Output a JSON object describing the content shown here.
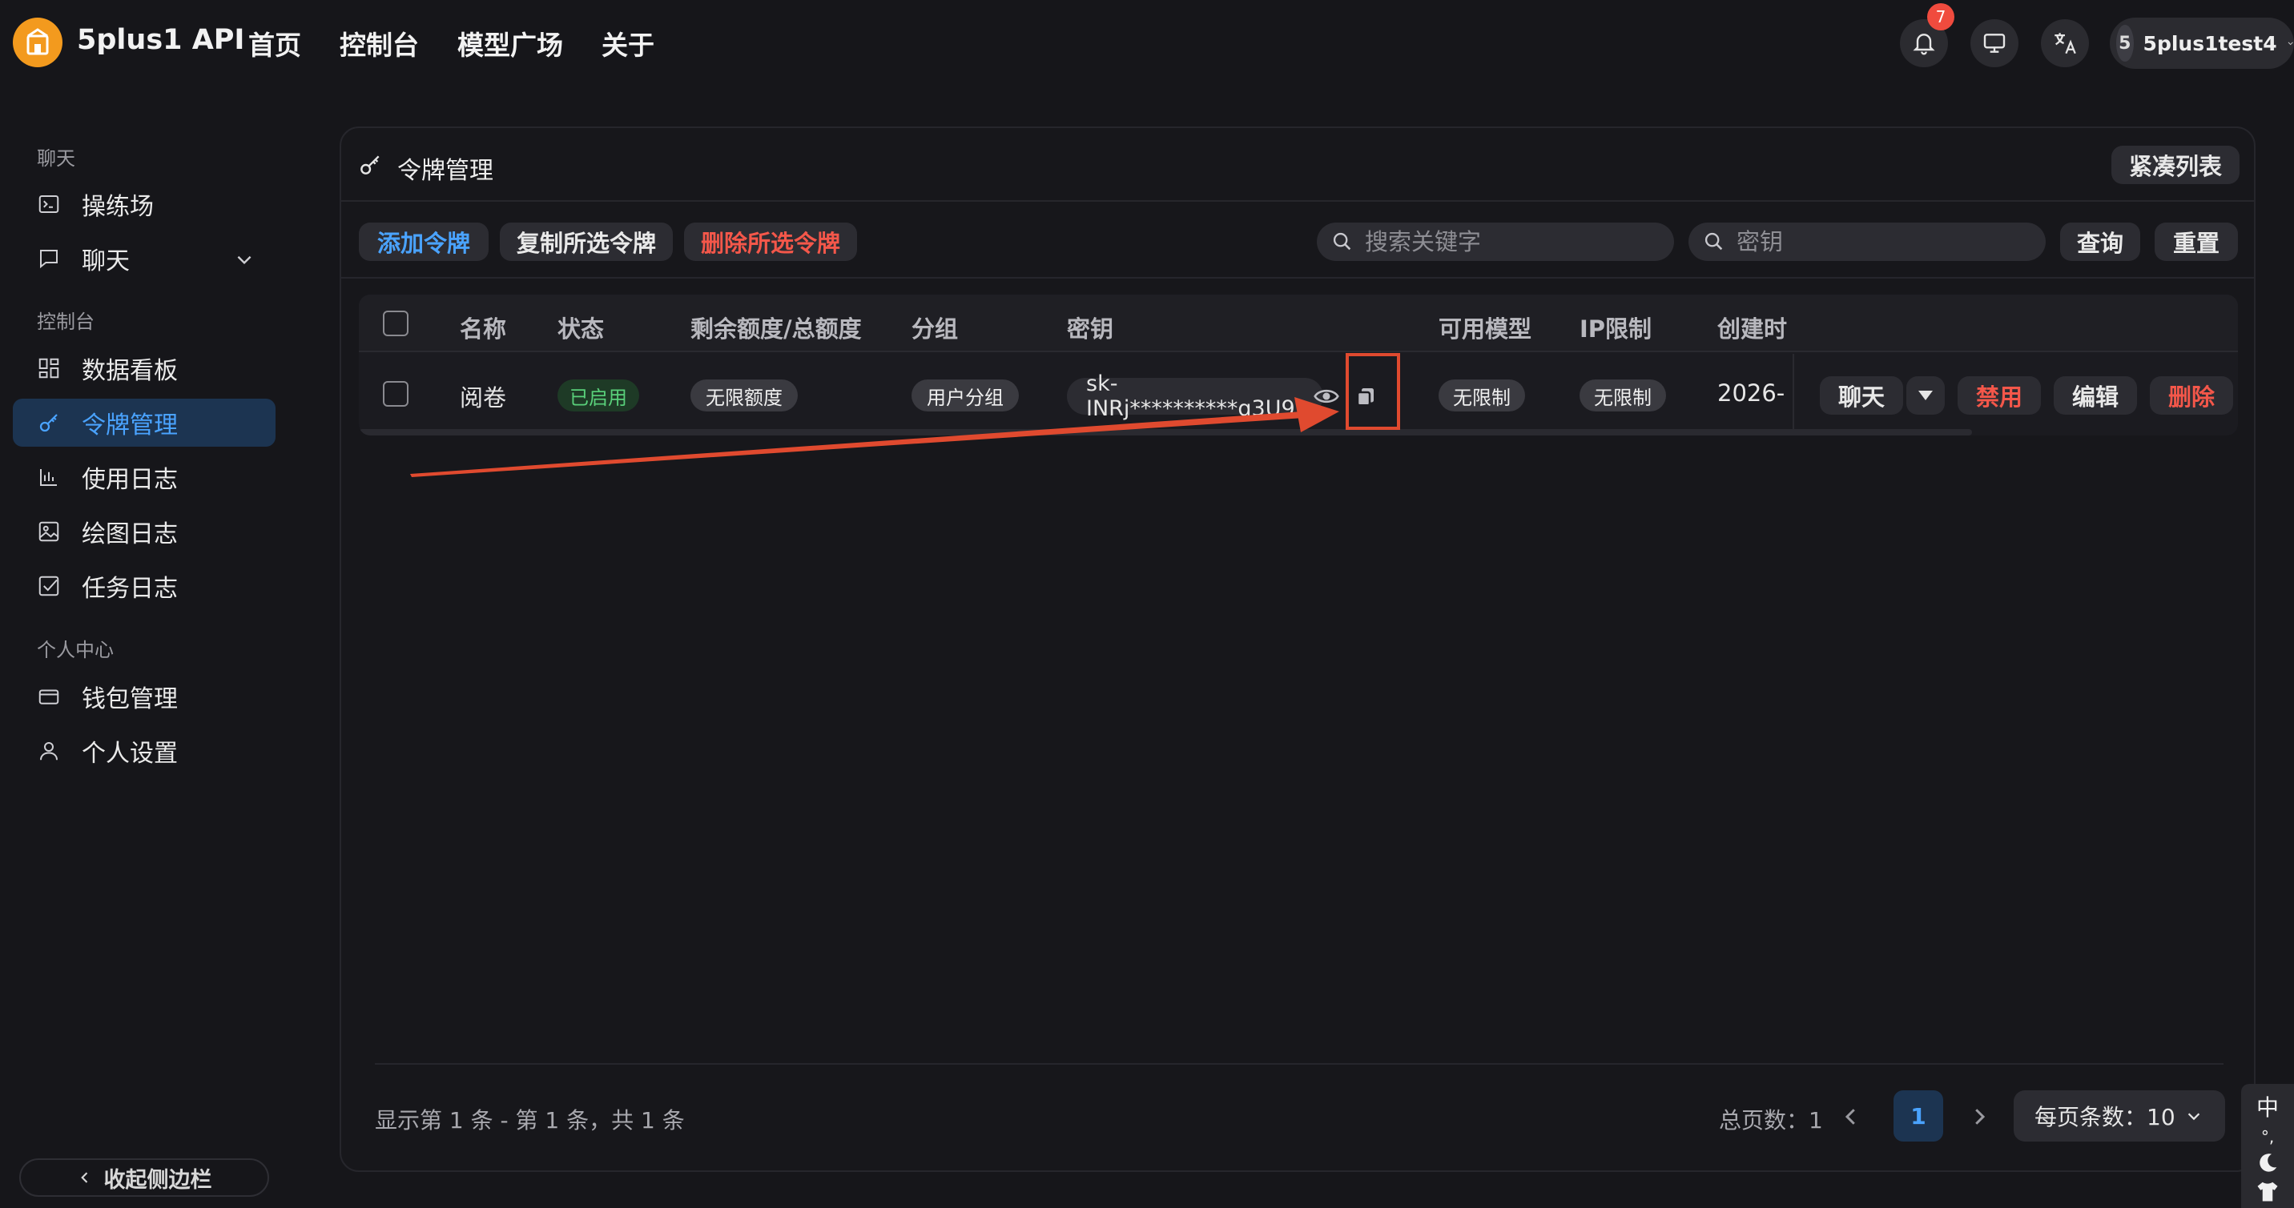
{
  "app": {
    "brand": "5plus1 API",
    "nav": [
      "首页",
      "控制台",
      "模型广场",
      "关于"
    ],
    "notification_count": "7",
    "user_avatar": "5",
    "user_name": "5plus1test4"
  },
  "sidebar": {
    "groups": [
      "聊天",
      "控制台",
      "个人中心"
    ],
    "items": [
      {
        "label": "操练场",
        "icon": "terminal-icon"
      },
      {
        "label": "聊天",
        "icon": "chat-bubble-icon"
      },
      {
        "label": "数据看板",
        "icon": "dashboard-icon"
      },
      {
        "label": "令牌管理",
        "icon": "key-icon",
        "active": true
      },
      {
        "label": "使用日志",
        "icon": "bar-chart-icon"
      },
      {
        "label": "绘图日志",
        "icon": "image-icon"
      },
      {
        "label": "任务日志",
        "icon": "checklist-icon"
      },
      {
        "label": "钱包管理",
        "icon": "wallet-icon"
      },
      {
        "label": "个人设置",
        "icon": "user-icon"
      }
    ],
    "collapse_label": "收起侧边栏"
  },
  "page": {
    "title": "令牌管理",
    "compact_button": "紧凑列表",
    "toolbar": {
      "add": "添加令牌",
      "copy_selected": "复制所选令牌",
      "delete_selected": "删除所选令牌",
      "search_keyword_placeholder": "搜索关键字",
      "search_key_placeholder": "密钥",
      "query": "查询",
      "reset": "重置"
    },
    "table": {
      "columns": [
        "名称",
        "状态",
        "剩余额度/总额度",
        "分组",
        "密钥",
        "可用模型",
        "IP限制",
        "创建时"
      ],
      "rows": [
        {
          "name": "阅卷",
          "status": "已启用",
          "quota": "无限额度",
          "group": "用户分组",
          "key": "sk-INRj**********q3U9",
          "models": "无限制",
          "ip": "无限制",
          "created": "2026-",
          "actions": {
            "chat": "聊天",
            "disable": "禁用",
            "edit": "编辑",
            "delete": "删除"
          }
        }
      ]
    },
    "footer": {
      "info": "显示第 1 条 - 第 1 条，共 1 条",
      "total_pages": "总页数：1",
      "current_page": "1",
      "page_size": "每页条数：10"
    }
  },
  "ime": {
    "lang": "中",
    "punct": "°,"
  },
  "colors": {
    "accent": "#4aa3ff",
    "danger": "#f4574a",
    "success": "#59d07a",
    "annotation": "#e04a2f",
    "logo": "#f39a1e"
  }
}
